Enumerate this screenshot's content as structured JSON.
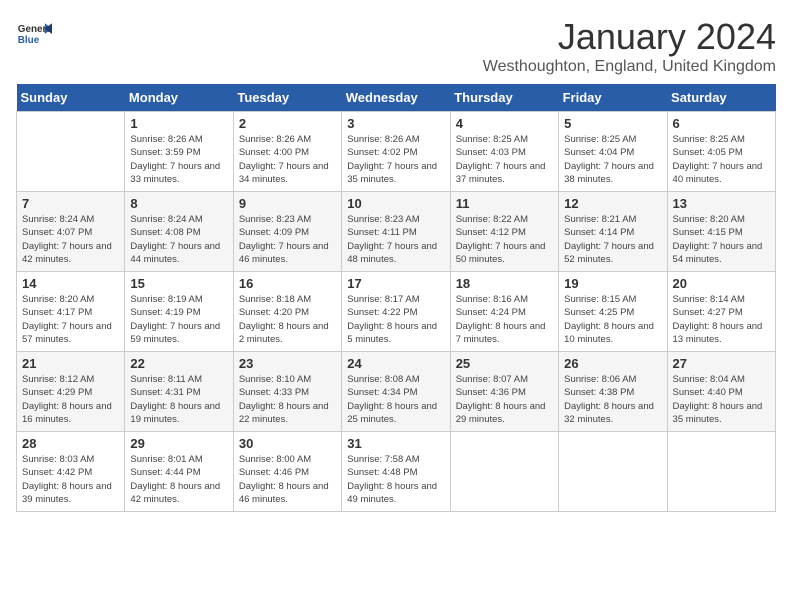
{
  "app": {
    "logo_general": "General",
    "logo_blue": "Blue",
    "month_title": "January 2024",
    "location": "Westhoughton, England, United Kingdom"
  },
  "calendar": {
    "headers": [
      "Sunday",
      "Monday",
      "Tuesday",
      "Wednesday",
      "Thursday",
      "Friday",
      "Saturday"
    ],
    "weeks": [
      [
        {
          "day": "",
          "sunrise": "",
          "sunset": "",
          "daylight": ""
        },
        {
          "day": "1",
          "sunrise": "Sunrise: 8:26 AM",
          "sunset": "Sunset: 3:59 PM",
          "daylight": "Daylight: 7 hours and 33 minutes."
        },
        {
          "day": "2",
          "sunrise": "Sunrise: 8:26 AM",
          "sunset": "Sunset: 4:00 PM",
          "daylight": "Daylight: 7 hours and 34 minutes."
        },
        {
          "day": "3",
          "sunrise": "Sunrise: 8:26 AM",
          "sunset": "Sunset: 4:02 PM",
          "daylight": "Daylight: 7 hours and 35 minutes."
        },
        {
          "day": "4",
          "sunrise": "Sunrise: 8:25 AM",
          "sunset": "Sunset: 4:03 PM",
          "daylight": "Daylight: 7 hours and 37 minutes."
        },
        {
          "day": "5",
          "sunrise": "Sunrise: 8:25 AM",
          "sunset": "Sunset: 4:04 PM",
          "daylight": "Daylight: 7 hours and 38 minutes."
        },
        {
          "day": "6",
          "sunrise": "Sunrise: 8:25 AM",
          "sunset": "Sunset: 4:05 PM",
          "daylight": "Daylight: 7 hours and 40 minutes."
        }
      ],
      [
        {
          "day": "7",
          "sunrise": "Sunrise: 8:24 AM",
          "sunset": "Sunset: 4:07 PM",
          "daylight": "Daylight: 7 hours and 42 minutes."
        },
        {
          "day": "8",
          "sunrise": "Sunrise: 8:24 AM",
          "sunset": "Sunset: 4:08 PM",
          "daylight": "Daylight: 7 hours and 44 minutes."
        },
        {
          "day": "9",
          "sunrise": "Sunrise: 8:23 AM",
          "sunset": "Sunset: 4:09 PM",
          "daylight": "Daylight: 7 hours and 46 minutes."
        },
        {
          "day": "10",
          "sunrise": "Sunrise: 8:23 AM",
          "sunset": "Sunset: 4:11 PM",
          "daylight": "Daylight: 7 hours and 48 minutes."
        },
        {
          "day": "11",
          "sunrise": "Sunrise: 8:22 AM",
          "sunset": "Sunset: 4:12 PM",
          "daylight": "Daylight: 7 hours and 50 minutes."
        },
        {
          "day": "12",
          "sunrise": "Sunrise: 8:21 AM",
          "sunset": "Sunset: 4:14 PM",
          "daylight": "Daylight: 7 hours and 52 minutes."
        },
        {
          "day": "13",
          "sunrise": "Sunrise: 8:20 AM",
          "sunset": "Sunset: 4:15 PM",
          "daylight": "Daylight: 7 hours and 54 minutes."
        }
      ],
      [
        {
          "day": "14",
          "sunrise": "Sunrise: 8:20 AM",
          "sunset": "Sunset: 4:17 PM",
          "daylight": "Daylight: 7 hours and 57 minutes."
        },
        {
          "day": "15",
          "sunrise": "Sunrise: 8:19 AM",
          "sunset": "Sunset: 4:19 PM",
          "daylight": "Daylight: 7 hours and 59 minutes."
        },
        {
          "day": "16",
          "sunrise": "Sunrise: 8:18 AM",
          "sunset": "Sunset: 4:20 PM",
          "daylight": "Daylight: 8 hours and 2 minutes."
        },
        {
          "day": "17",
          "sunrise": "Sunrise: 8:17 AM",
          "sunset": "Sunset: 4:22 PM",
          "daylight": "Daylight: 8 hours and 5 minutes."
        },
        {
          "day": "18",
          "sunrise": "Sunrise: 8:16 AM",
          "sunset": "Sunset: 4:24 PM",
          "daylight": "Daylight: 8 hours and 7 minutes."
        },
        {
          "day": "19",
          "sunrise": "Sunrise: 8:15 AM",
          "sunset": "Sunset: 4:25 PM",
          "daylight": "Daylight: 8 hours and 10 minutes."
        },
        {
          "day": "20",
          "sunrise": "Sunrise: 8:14 AM",
          "sunset": "Sunset: 4:27 PM",
          "daylight": "Daylight: 8 hours and 13 minutes."
        }
      ],
      [
        {
          "day": "21",
          "sunrise": "Sunrise: 8:12 AM",
          "sunset": "Sunset: 4:29 PM",
          "daylight": "Daylight: 8 hours and 16 minutes."
        },
        {
          "day": "22",
          "sunrise": "Sunrise: 8:11 AM",
          "sunset": "Sunset: 4:31 PM",
          "daylight": "Daylight: 8 hours and 19 minutes."
        },
        {
          "day": "23",
          "sunrise": "Sunrise: 8:10 AM",
          "sunset": "Sunset: 4:33 PM",
          "daylight": "Daylight: 8 hours and 22 minutes."
        },
        {
          "day": "24",
          "sunrise": "Sunrise: 8:08 AM",
          "sunset": "Sunset: 4:34 PM",
          "daylight": "Daylight: 8 hours and 25 minutes."
        },
        {
          "day": "25",
          "sunrise": "Sunrise: 8:07 AM",
          "sunset": "Sunset: 4:36 PM",
          "daylight": "Daylight: 8 hours and 29 minutes."
        },
        {
          "day": "26",
          "sunrise": "Sunrise: 8:06 AM",
          "sunset": "Sunset: 4:38 PM",
          "daylight": "Daylight: 8 hours and 32 minutes."
        },
        {
          "day": "27",
          "sunrise": "Sunrise: 8:04 AM",
          "sunset": "Sunset: 4:40 PM",
          "daylight": "Daylight: 8 hours and 35 minutes."
        }
      ],
      [
        {
          "day": "28",
          "sunrise": "Sunrise: 8:03 AM",
          "sunset": "Sunset: 4:42 PM",
          "daylight": "Daylight: 8 hours and 39 minutes."
        },
        {
          "day": "29",
          "sunrise": "Sunrise: 8:01 AM",
          "sunset": "Sunset: 4:44 PM",
          "daylight": "Daylight: 8 hours and 42 minutes."
        },
        {
          "day": "30",
          "sunrise": "Sunrise: 8:00 AM",
          "sunset": "Sunset: 4:46 PM",
          "daylight": "Daylight: 8 hours and 46 minutes."
        },
        {
          "day": "31",
          "sunrise": "Sunrise: 7:58 AM",
          "sunset": "Sunset: 4:48 PM",
          "daylight": "Daylight: 8 hours and 49 minutes."
        },
        {
          "day": "",
          "sunrise": "",
          "sunset": "",
          "daylight": ""
        },
        {
          "day": "",
          "sunrise": "",
          "sunset": "",
          "daylight": ""
        },
        {
          "day": "",
          "sunrise": "",
          "sunset": "",
          "daylight": ""
        }
      ]
    ]
  }
}
